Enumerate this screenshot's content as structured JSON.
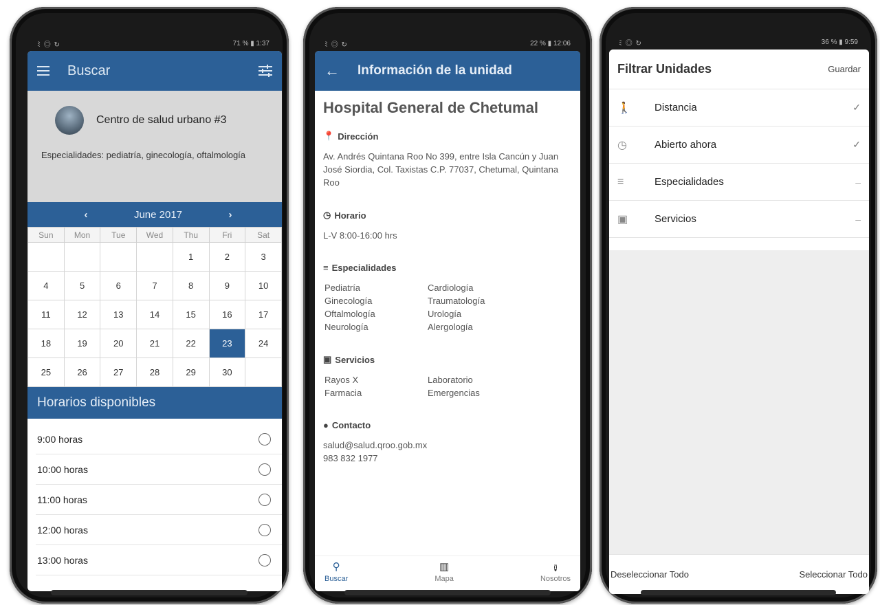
{
  "phone1": {
    "status": {
      "left": "ﾐ ◎ ↻",
      "right": "71 % ▮ 1:37"
    },
    "appbar": {
      "title": "Buscar"
    },
    "center": {
      "name": "Centro de salud urbano #3",
      "specialties": "Especialidades: pediatría, ginecología, oftalmología"
    },
    "calendar": {
      "prev": "‹",
      "month": "June 2017",
      "next": "›",
      "weekdays": [
        "Sun",
        "Mon",
        "Tue",
        "Wed",
        "Thu",
        "Fri",
        "Sat"
      ],
      "weeks": [
        [
          "",
          "",
          "",
          "",
          "1",
          "2",
          "3"
        ],
        [
          "4",
          "5",
          "6",
          "7",
          "8",
          "9",
          "10"
        ],
        [
          "11",
          "12",
          "13",
          "14",
          "15",
          "16",
          "17"
        ],
        [
          "18",
          "19",
          "20",
          "21",
          "22",
          "23",
          "24"
        ],
        [
          "25",
          "26",
          "27",
          "28",
          "29",
          "30",
          ""
        ]
      ],
      "selected_day": "23"
    },
    "slots": {
      "header": "Horarios disponibles",
      "items": [
        "9:00 horas",
        "10:00 horas",
        "11:00 horas",
        "12:00 horas",
        "13:00 horas"
      ]
    }
  },
  "phone2": {
    "status": {
      "left": "ﾐ ◎ ↻",
      "right": "22 % ▮ 12:06"
    },
    "appbar": {
      "title": "Información de la unidad"
    },
    "hospital_name": "Hospital General de Chetumal",
    "direccion": {
      "title": "Dirección",
      "text": "Av. Andrés Quintana Roo No 399, entre Isla Cancún y Juan José Siordia, Col. Taxistas C.P. 77037, Chetumal, Quintana Roo"
    },
    "horario": {
      "title": "Horario",
      "text": "L-V 8:00-16:00 hrs"
    },
    "especialidades": {
      "title": "Especialidades",
      "items": [
        "Pediatría",
        "Cardiología",
        "Ginecología",
        "Traumatología",
        "Oftalmología",
        "Urología",
        "Neurología",
        "Alergología"
      ]
    },
    "servicios": {
      "title": "Servicios",
      "items": [
        "Rayos X",
        "Laboratorio",
        "Farmacia",
        "Emergencias"
      ]
    },
    "contacto": {
      "title": "Contacto",
      "email": "salud@salud.qroo.gob.mx",
      "phone": "983 832 1977"
    },
    "nav": {
      "search": "Buscar",
      "map": "Mapa",
      "about": "Nosotros"
    }
  },
  "phone3": {
    "status": {
      "left": "ﾐ ◎ ↻",
      "right": "36 % ▮ 9:59"
    },
    "header": {
      "title": "Filtrar Unidades",
      "save": "Guardar"
    },
    "filters": [
      {
        "label": "Distancia",
        "icon": "walk-icon",
        "state": "check"
      },
      {
        "label": "Abierto ahora",
        "icon": "clock-icon",
        "state": "check"
      },
      {
        "label": "Especialidades",
        "icon": "list-icon",
        "state": "dash"
      },
      {
        "label": "Servicios",
        "icon": "medkit-icon",
        "state": "dash"
      }
    ],
    "footer": {
      "deselect": "Deseleccionar Todo",
      "select": "Seleccionar Todo"
    }
  },
  "colors": {
    "primary": "#2c6097",
    "card_gray": "#d8d8d8"
  }
}
